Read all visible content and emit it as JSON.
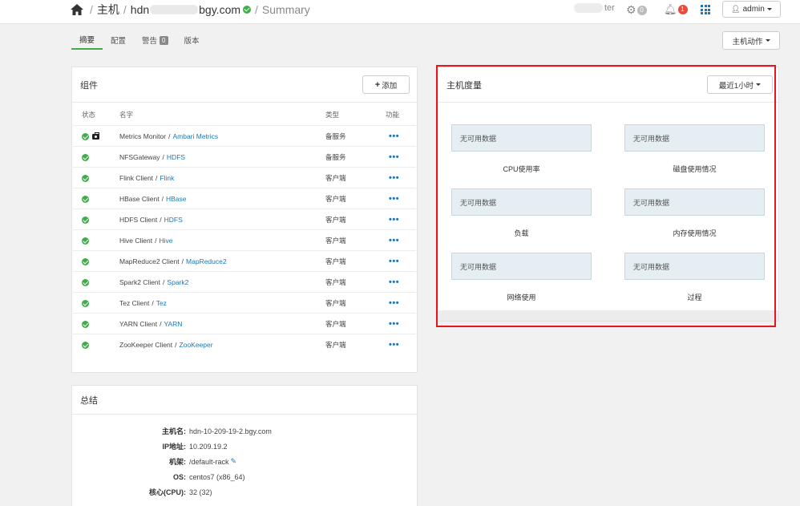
{
  "breadcrumb": {
    "section": "主机",
    "host_prefix": "hdn",
    "host_suffix": "bgy.com",
    "page": "Summary"
  },
  "topbar": {
    "cluster_suffix": "ter",
    "ops_count": "0",
    "alerts_count": "1",
    "user": "admin"
  },
  "tabs": {
    "summary": "摘要",
    "configs": "配置",
    "alerts": "警告",
    "alerts_count": "0",
    "versions": "版本"
  },
  "host_actions_label": "主机动作",
  "components": {
    "title": "组件",
    "add_label": "添加",
    "headers": {
      "status": "状态",
      "name": "名字",
      "type": "类型",
      "action": "功能"
    },
    "rows": [
      {
        "name": "Metrics Monitor",
        "service": "Ambari Metrics",
        "type": "备服务"
      },
      {
        "name": "NFSGateway",
        "service": "HDFS",
        "type": "备服务"
      },
      {
        "name": "Flink Client",
        "service": "Flink",
        "type": "客户端"
      },
      {
        "name": "HBase Client",
        "service": "HBase",
        "type": "客户端"
      },
      {
        "name": "HDFS Client",
        "service": "HDFS",
        "type": "客户端"
      },
      {
        "name": "Hive Client",
        "service": "Hive",
        "type": "客户端"
      },
      {
        "name": "MapReduce2 Client",
        "service": "MapReduce2",
        "type": "客户端"
      },
      {
        "name": "Spark2 Client",
        "service": "Spark2",
        "type": "客户端"
      },
      {
        "name": "Tez Client",
        "service": "Tez",
        "type": "客户端"
      },
      {
        "name": "YARN Client",
        "service": "YARN",
        "type": "客户端"
      },
      {
        "name": "ZooKeeper Client",
        "service": "ZooKeeper",
        "type": "客户端"
      }
    ],
    "actions_glyph": "•••"
  },
  "metrics": {
    "title": "主机度量",
    "range_label": "最近1小时",
    "no_data": "无可用数据",
    "charts": [
      "CPU使用率",
      "磁盘使用情况",
      "负载",
      "内存使用情况",
      "网络使用",
      "过程"
    ]
  },
  "summary": {
    "title": "总结",
    "rows": [
      {
        "key": "主机名:",
        "value": "hdn-10-209-19-2.bgy.com"
      },
      {
        "key": "IP地址:",
        "value": "10.209.19.2"
      },
      {
        "key": "机架:",
        "value": "/default-rack"
      },
      {
        "key": "OS:",
        "value": "centos7 (x86_64)"
      },
      {
        "key": "核心(CPU):",
        "value": "32 (32)"
      }
    ]
  },
  "colors": {
    "accent": "#1b78b4",
    "ok": "#3fae49",
    "highlight": "#e8141e"
  }
}
